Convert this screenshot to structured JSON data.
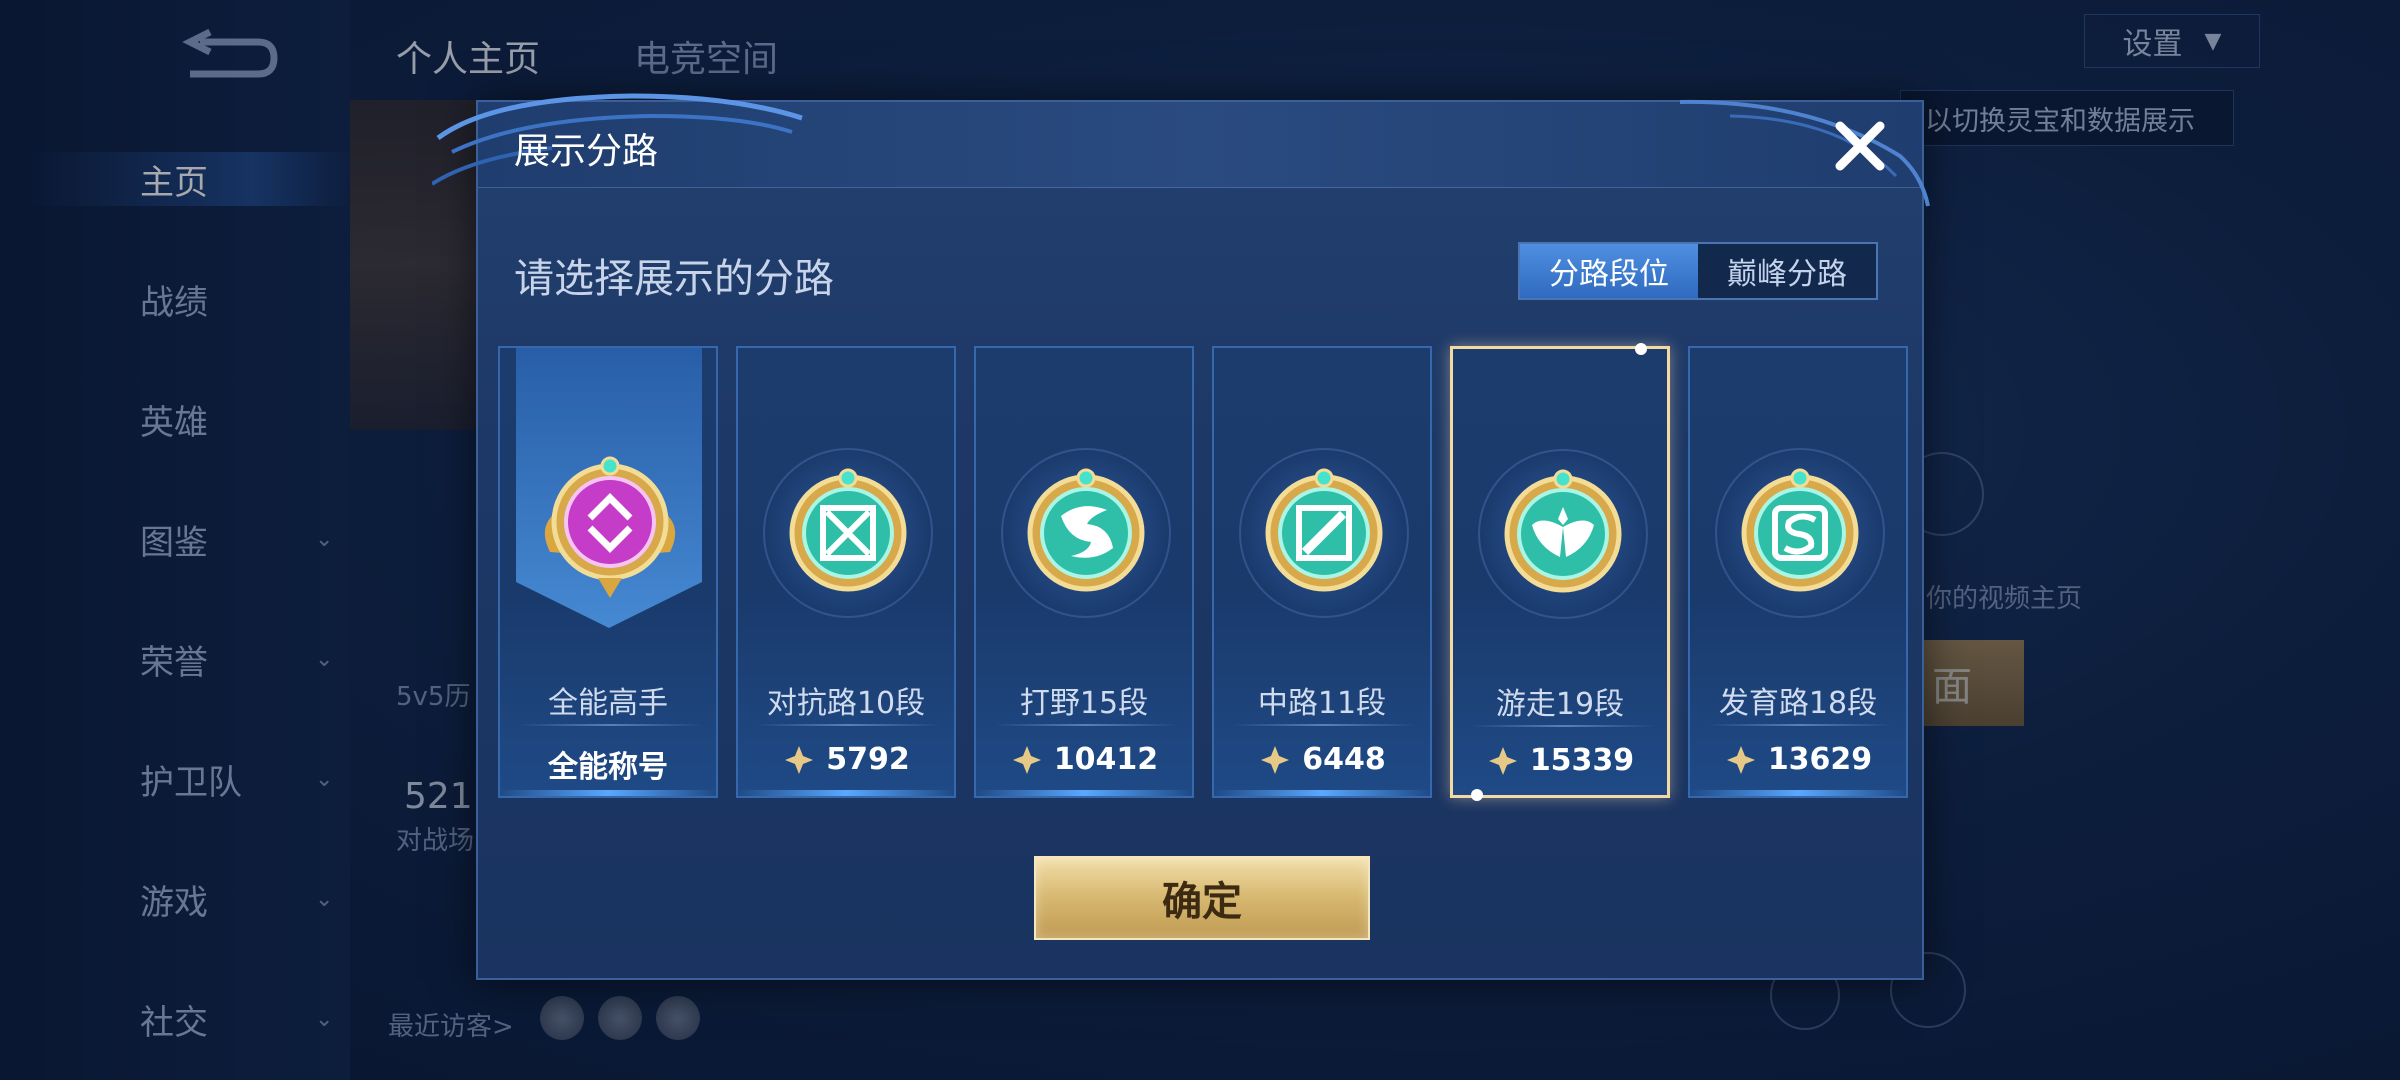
{
  "sidebar": {
    "items": [
      {
        "label": "主页",
        "active": true,
        "chevron": false
      },
      {
        "label": "战绩",
        "active": false,
        "chevron": false
      },
      {
        "label": "英雄",
        "active": false,
        "chevron": false
      },
      {
        "label": "图鉴",
        "active": false,
        "chevron": true
      },
      {
        "label": "荣誉",
        "active": false,
        "chevron": true
      },
      {
        "label": "护卫队",
        "active": false,
        "chevron": true
      },
      {
        "label": "游戏",
        "active": false,
        "chevron": true
      },
      {
        "label": "社交",
        "active": false,
        "chevron": true
      }
    ]
  },
  "top_tabs": {
    "personal": "个人主页",
    "esports": "电竞空间"
  },
  "settings": {
    "label": "设置"
  },
  "hint": {
    "text": "以切换灵宝和数据展示"
  },
  "background": {
    "history_label": "5v5历",
    "count": "521",
    "battle_label": "对战场",
    "recent_visitors": "最近访客>",
    "video_home": "到你的视频主页",
    "gold_btn": "面"
  },
  "modal": {
    "title": "展示分路",
    "subtitle": "请选择展示的分路",
    "toggle": {
      "options": [
        "分路段位",
        "巅峰分路"
      ],
      "selected": "分路段位"
    },
    "cards": [
      {
        "name": "全能高手",
        "value": "全能称号",
        "emblem": "allround-emblem-icon",
        "selected": false
      },
      {
        "name": "对抗路10段",
        "value": "5792",
        "emblem": "clash-lane-emblem-icon",
        "selected": false
      },
      {
        "name": "打野15段",
        "value": "10412",
        "emblem": "jungle-emblem-icon",
        "selected": false
      },
      {
        "name": "中路11段",
        "value": "6448",
        "emblem": "mid-lane-emblem-icon",
        "selected": false
      },
      {
        "name": "游走19段",
        "value": "15339",
        "emblem": "roam-emblem-icon",
        "selected": true
      },
      {
        "name": "发育路18段",
        "value": "13629",
        "emblem": "farm-lane-emblem-icon",
        "selected": false
      }
    ],
    "confirm": "确定"
  },
  "colors": {
    "accent_blue": "#2f6bc0",
    "gold": "#d9bb74",
    "selected_border": "#f3d9a6",
    "emblem_teal": "#3fd6c0",
    "emblem_purple": "#c43cc8"
  }
}
